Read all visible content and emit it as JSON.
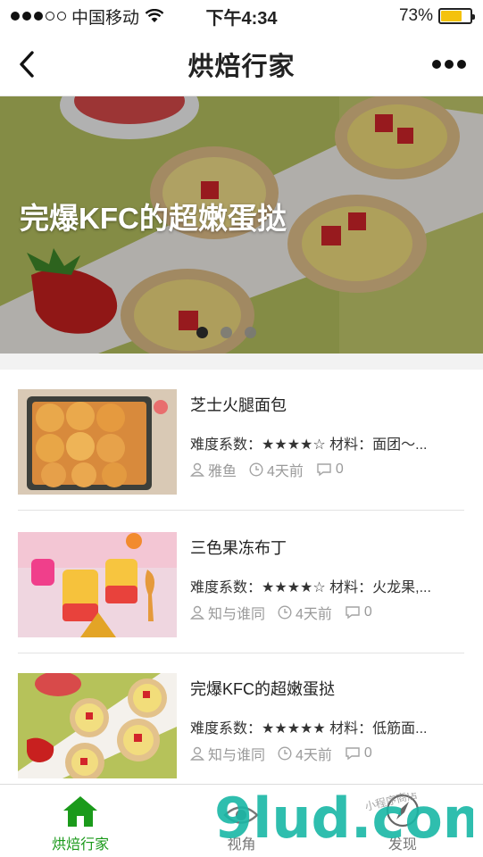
{
  "status": {
    "carrier": "中国移动",
    "time": "下午4:34",
    "battery": "73%",
    "battery_level": 0.73
  },
  "nav": {
    "title": "烘焙行家"
  },
  "banner": {
    "title": "完爆KFC的超嫩蛋挞",
    "slide_count": 3,
    "active_slide": 0
  },
  "recipes": [
    {
      "title": "芝士火腿面包",
      "meta": "难度系数：★★★★☆ 材料：面团～...",
      "author": "雅鱼",
      "time": "4天前",
      "comments": "0"
    },
    {
      "title": "三色果冻布丁",
      "meta": "难度系数：★★★★☆ 材料：火龙果,...",
      "author": "知与谁同",
      "time": "4天前",
      "comments": "0"
    },
    {
      "title": "完爆KFC的超嫩蛋挞",
      "meta": "难度系数：★★★★★ 材料：低筋面...",
      "author": "知与谁同",
      "time": "4天前",
      "comments": "0"
    }
  ],
  "tabs": [
    {
      "label": "烘焙行家",
      "icon": "home-icon"
    },
    {
      "label": "视角",
      "icon": "eye-icon"
    },
    {
      "label": "发现",
      "icon": "compass-icon"
    }
  ],
  "watermark": {
    "text": "9lud.com",
    "subtext": "小程序商店"
  },
  "colors": {
    "accent": "#1b9a1b",
    "watermark": "#19b7a6",
    "watermark_dot": "#f39a1e"
  }
}
